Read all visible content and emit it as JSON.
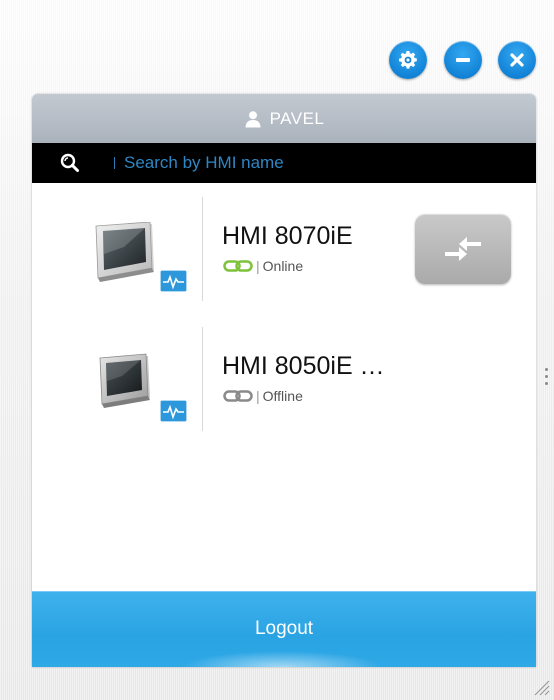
{
  "window": {
    "controls": {
      "settings_icon": "gear-icon",
      "minimize_icon": "minus-icon",
      "close_icon": "close-icon"
    }
  },
  "user": {
    "name": "PAVEL",
    "icon": "person-icon"
  },
  "search": {
    "placeholder": "Search by HMI name",
    "value": ""
  },
  "devices": [
    {
      "name": "HMI 8070iE",
      "status": "Online",
      "status_color": "#7dc23a",
      "has_connect_button": true
    },
    {
      "name": "HMI 8050iE …",
      "status": "Offline",
      "status_color": "#8a8a8a",
      "has_connect_button": false
    }
  ],
  "footer": {
    "logout_label": "Logout"
  },
  "colors": {
    "accent": "#2aa3e3",
    "control_blue": "#1283d6",
    "header_gray": "#b4bcc5",
    "search_bg": "#000000",
    "search_text": "#2f86c4"
  }
}
